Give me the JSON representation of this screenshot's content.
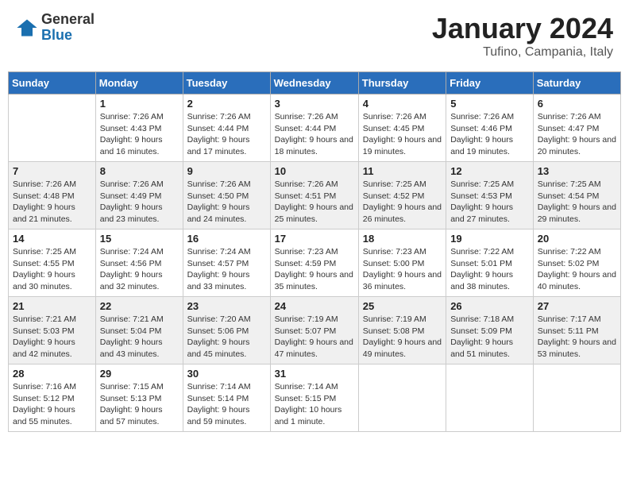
{
  "header": {
    "logo": {
      "general": "General",
      "blue": "Blue"
    },
    "title": "January 2024",
    "subtitle": "Tufino, Campania, Italy"
  },
  "weekdays": [
    "Sunday",
    "Monday",
    "Tuesday",
    "Wednesday",
    "Thursday",
    "Friday",
    "Saturday"
  ],
  "weeks": [
    [
      null,
      {
        "num": "1",
        "sunrise": "7:26 AM",
        "sunset": "4:43 PM",
        "daylight": "9 hours and 16 minutes."
      },
      {
        "num": "2",
        "sunrise": "7:26 AM",
        "sunset": "4:44 PM",
        "daylight": "9 hours and 17 minutes."
      },
      {
        "num": "3",
        "sunrise": "7:26 AM",
        "sunset": "4:44 PM",
        "daylight": "9 hours and 18 minutes."
      },
      {
        "num": "4",
        "sunrise": "7:26 AM",
        "sunset": "4:45 PM",
        "daylight": "9 hours and 19 minutes."
      },
      {
        "num": "5",
        "sunrise": "7:26 AM",
        "sunset": "4:46 PM",
        "daylight": "9 hours and 19 minutes."
      },
      {
        "num": "6",
        "sunrise": "7:26 AM",
        "sunset": "4:47 PM",
        "daylight": "9 hours and 20 minutes."
      }
    ],
    [
      {
        "num": "7",
        "sunrise": "7:26 AM",
        "sunset": "4:48 PM",
        "daylight": "9 hours and 21 minutes."
      },
      {
        "num": "8",
        "sunrise": "7:26 AM",
        "sunset": "4:49 PM",
        "daylight": "9 hours and 23 minutes."
      },
      {
        "num": "9",
        "sunrise": "7:26 AM",
        "sunset": "4:50 PM",
        "daylight": "9 hours and 24 minutes."
      },
      {
        "num": "10",
        "sunrise": "7:26 AM",
        "sunset": "4:51 PM",
        "daylight": "9 hours and 25 minutes."
      },
      {
        "num": "11",
        "sunrise": "7:25 AM",
        "sunset": "4:52 PM",
        "daylight": "9 hours and 26 minutes."
      },
      {
        "num": "12",
        "sunrise": "7:25 AM",
        "sunset": "4:53 PM",
        "daylight": "9 hours and 27 minutes."
      },
      {
        "num": "13",
        "sunrise": "7:25 AM",
        "sunset": "4:54 PM",
        "daylight": "9 hours and 29 minutes."
      }
    ],
    [
      {
        "num": "14",
        "sunrise": "7:25 AM",
        "sunset": "4:55 PM",
        "daylight": "9 hours and 30 minutes."
      },
      {
        "num": "15",
        "sunrise": "7:24 AM",
        "sunset": "4:56 PM",
        "daylight": "9 hours and 32 minutes."
      },
      {
        "num": "16",
        "sunrise": "7:24 AM",
        "sunset": "4:57 PM",
        "daylight": "9 hours and 33 minutes."
      },
      {
        "num": "17",
        "sunrise": "7:23 AM",
        "sunset": "4:59 PM",
        "daylight": "9 hours and 35 minutes."
      },
      {
        "num": "18",
        "sunrise": "7:23 AM",
        "sunset": "5:00 PM",
        "daylight": "9 hours and 36 minutes."
      },
      {
        "num": "19",
        "sunrise": "7:22 AM",
        "sunset": "5:01 PM",
        "daylight": "9 hours and 38 minutes."
      },
      {
        "num": "20",
        "sunrise": "7:22 AM",
        "sunset": "5:02 PM",
        "daylight": "9 hours and 40 minutes."
      }
    ],
    [
      {
        "num": "21",
        "sunrise": "7:21 AM",
        "sunset": "5:03 PM",
        "daylight": "9 hours and 42 minutes."
      },
      {
        "num": "22",
        "sunrise": "7:21 AM",
        "sunset": "5:04 PM",
        "daylight": "9 hours and 43 minutes."
      },
      {
        "num": "23",
        "sunrise": "7:20 AM",
        "sunset": "5:06 PM",
        "daylight": "9 hours and 45 minutes."
      },
      {
        "num": "24",
        "sunrise": "7:19 AM",
        "sunset": "5:07 PM",
        "daylight": "9 hours and 47 minutes."
      },
      {
        "num": "25",
        "sunrise": "7:19 AM",
        "sunset": "5:08 PM",
        "daylight": "9 hours and 49 minutes."
      },
      {
        "num": "26",
        "sunrise": "7:18 AM",
        "sunset": "5:09 PM",
        "daylight": "9 hours and 51 minutes."
      },
      {
        "num": "27",
        "sunrise": "7:17 AM",
        "sunset": "5:11 PM",
        "daylight": "9 hours and 53 minutes."
      }
    ],
    [
      {
        "num": "28",
        "sunrise": "7:16 AM",
        "sunset": "5:12 PM",
        "daylight": "9 hours and 55 minutes."
      },
      {
        "num": "29",
        "sunrise": "7:15 AM",
        "sunset": "5:13 PM",
        "daylight": "9 hours and 57 minutes."
      },
      {
        "num": "30",
        "sunrise": "7:14 AM",
        "sunset": "5:14 PM",
        "daylight": "9 hours and 59 minutes."
      },
      {
        "num": "31",
        "sunrise": "7:14 AM",
        "sunset": "5:15 PM",
        "daylight": "10 hours and 1 minute."
      },
      null,
      null,
      null
    ]
  ],
  "labels": {
    "sunrise": "Sunrise:",
    "sunset": "Sunset:",
    "daylight": "Daylight:"
  }
}
